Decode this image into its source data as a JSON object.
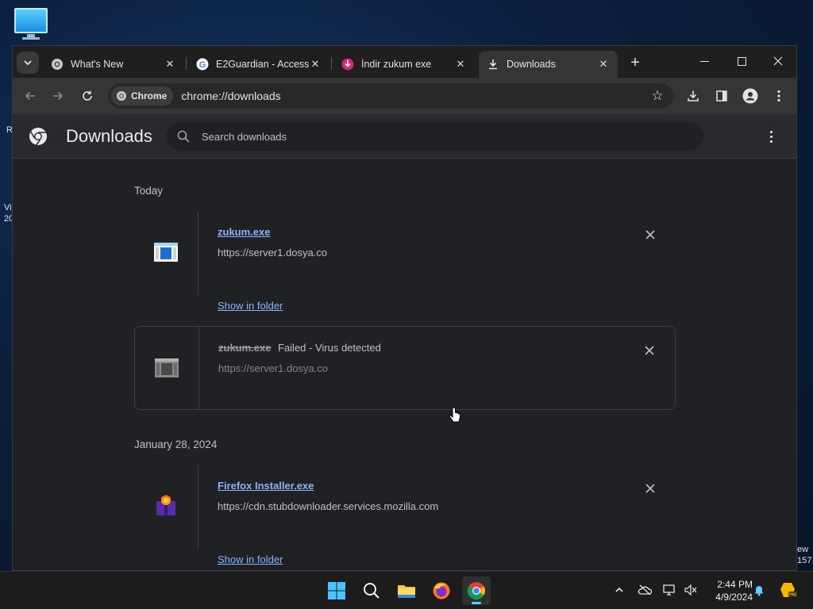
{
  "desktop": {
    "edge_texts": [
      "R",
      "Vi",
      "20",
      "ew",
      "157"
    ]
  },
  "window": {
    "tabs": [
      {
        "title": "What's New",
        "favicon": "chrome-icon"
      },
      {
        "title": "E2Guardian - Access",
        "favicon": "google-icon"
      },
      {
        "title": "İndir zukum exe",
        "favicon": "download-site-icon"
      },
      {
        "title": "Downloads",
        "favicon": "download-icon"
      }
    ],
    "active_tab": 3
  },
  "toolbar": {
    "chip_label": "Chrome",
    "url": "chrome://downloads"
  },
  "page": {
    "title": "Downloads",
    "search_placeholder": "Search downloads"
  },
  "groups": [
    {
      "date": "Today",
      "items": [
        {
          "name": "zukum.exe",
          "source": "https://server1.dosya.co",
          "action": "Show in folder",
          "state": "complete",
          "icon": "exe-file-icon"
        },
        {
          "name": "zukum.exe",
          "status": "Failed - Virus detected",
          "source": "https://server1.dosya.co",
          "state": "failed",
          "icon": "exe-file-icon"
        }
      ]
    },
    {
      "date": "January 28, 2024",
      "items": [
        {
          "name": "Firefox Installer.exe",
          "source": "https://cdn.stubdownloader.services.mozilla.com",
          "action": "Show in folder",
          "state": "complete",
          "icon": "firefox-installer-icon"
        }
      ]
    }
  ],
  "taskbar": {
    "time": "2:44 PM",
    "date": "4/9/2024"
  },
  "colors": {
    "accent_link": "#8ab4f8",
    "page_bg": "#202124",
    "toolbar_bg": "#353535"
  }
}
